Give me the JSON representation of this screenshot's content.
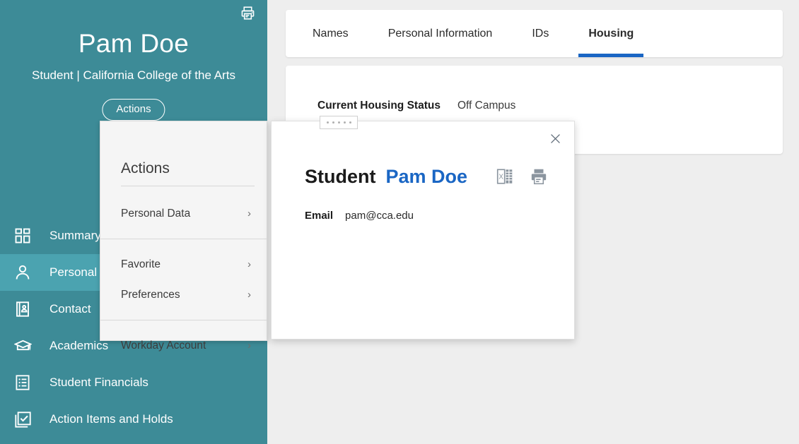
{
  "sidebar": {
    "print_icon": "print-icon",
    "profile": {
      "name": "Pam Doe",
      "subtitle": "Student | California College of the Arts",
      "actions_label": "Actions"
    },
    "colors": {
      "background": "#3d8b97",
      "active": "#4ba3b0"
    },
    "nav_items": [
      {
        "label": "Summary",
        "icon": "grid-icon",
        "active": false
      },
      {
        "label": "Personal",
        "icon": "person-icon",
        "active": true
      },
      {
        "label": "Contact",
        "icon": "contact-card-icon",
        "active": false
      },
      {
        "label": "Academics",
        "icon": "graduation-cap-icon",
        "active": false
      },
      {
        "label": "Student Financials",
        "icon": "list-document-icon",
        "active": false
      },
      {
        "label": "Action Items and Holds",
        "icon": "checklist-stack-icon",
        "active": false
      }
    ]
  },
  "main": {
    "tabs": [
      {
        "label": "Names",
        "active": false
      },
      {
        "label": "Personal Information",
        "active": false
      },
      {
        "label": "IDs",
        "active": false
      },
      {
        "label": "Housing",
        "active": true
      }
    ],
    "active_tab_underline_color": "#1a66c4",
    "housing": {
      "status_label": "Current Housing Status",
      "status_value": "Off Campus"
    }
  },
  "actions_menu": {
    "title": "Actions",
    "items": [
      {
        "label": "Personal Data",
        "chevron": "chevron-right-icon"
      },
      {
        "label": "Favorite",
        "chevron": "chevron-right-icon"
      },
      {
        "label": "Preferences",
        "chevron": "chevron-right-icon"
      },
      {
        "label": "Workday Account",
        "chevron": "chevron-right-icon"
      }
    ]
  },
  "popup": {
    "drag_handle": "drag-handle-dots",
    "close_icon": "close-icon",
    "title": "Student",
    "person_link": "Pam Doe",
    "excel_icon": "excel-export-icon",
    "print_icon": "print-icon",
    "link_color": "#1a66c4",
    "fields": [
      {
        "label": "Email",
        "value": "pam@cca.edu"
      }
    ]
  }
}
